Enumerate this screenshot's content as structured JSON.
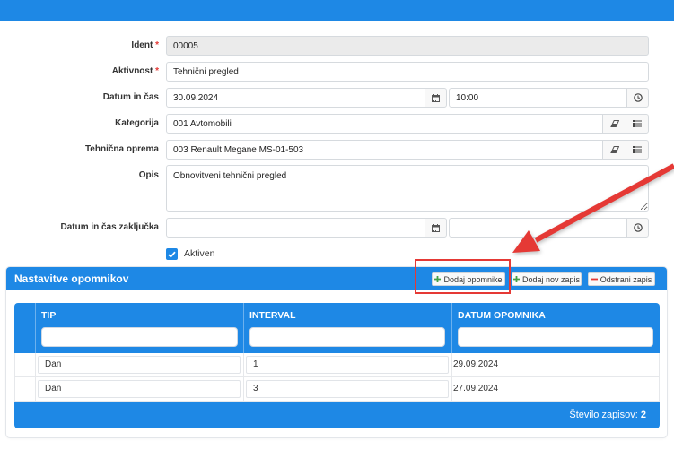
{
  "theme": {
    "primary": "#1e88e5",
    "required_mark_color": "#e53935",
    "add_icon_color": "#43a047",
    "remove_icon_color": "#e53935",
    "annotation_color": "#e53935"
  },
  "form": {
    "ident": {
      "label": "Ident",
      "required_mark": "*",
      "value": "00005",
      "disabled": true
    },
    "aktivnost": {
      "label": "Aktivnost",
      "required_mark": "*",
      "value": "Tehnični pregled"
    },
    "datum_in_cas": {
      "label": "Datum in čas",
      "date": "30.09.2024",
      "time": "10:00",
      "date_icon": "calendar-icon",
      "time_icon": "clock-icon"
    },
    "kategorija": {
      "label": "Kategorija",
      "value": "001 Avtomobili",
      "clear_icon": "eraser-icon",
      "list_icon": "list-icon"
    },
    "tehnicna_oprema": {
      "label": "Tehnična oprema",
      "value": "003 Renault Megane MS-01-503",
      "clear_icon": "eraser-icon",
      "list_icon": "list-icon"
    },
    "opis": {
      "label": "Opis",
      "value": "Obnovitveni tehnični pregled"
    },
    "datum_zakljucka": {
      "label": "Datum in čas zaključka",
      "date": "",
      "time": "",
      "date_icon": "calendar-icon",
      "time_icon": "clock-icon"
    },
    "aktiven": {
      "label": "Aktiven",
      "checked": true
    }
  },
  "reminders": {
    "title": "Nastavitve opomnikov",
    "buttons": {
      "add_reminders": {
        "label": "Dodaj opomnike",
        "icon": "plus-icon"
      },
      "add_record": {
        "label": "Dodaj nov zapis",
        "icon": "plus-icon"
      },
      "remove_record": {
        "label": "Odstrani zapis",
        "icon": "minus-icon"
      }
    },
    "columns": [
      "TIP",
      "INTERVAL",
      "DATUM OPOMNIKA"
    ],
    "filter_values": [
      "",
      "",
      ""
    ],
    "rows": [
      {
        "tip": "Dan",
        "interval": "1",
        "datum_opomnika": "29.09.2024"
      },
      {
        "tip": "Dan",
        "interval": "3",
        "datum_opomnika": "27.09.2024"
      }
    ],
    "footer": {
      "label": "Število zapisov:",
      "count": 2
    }
  }
}
